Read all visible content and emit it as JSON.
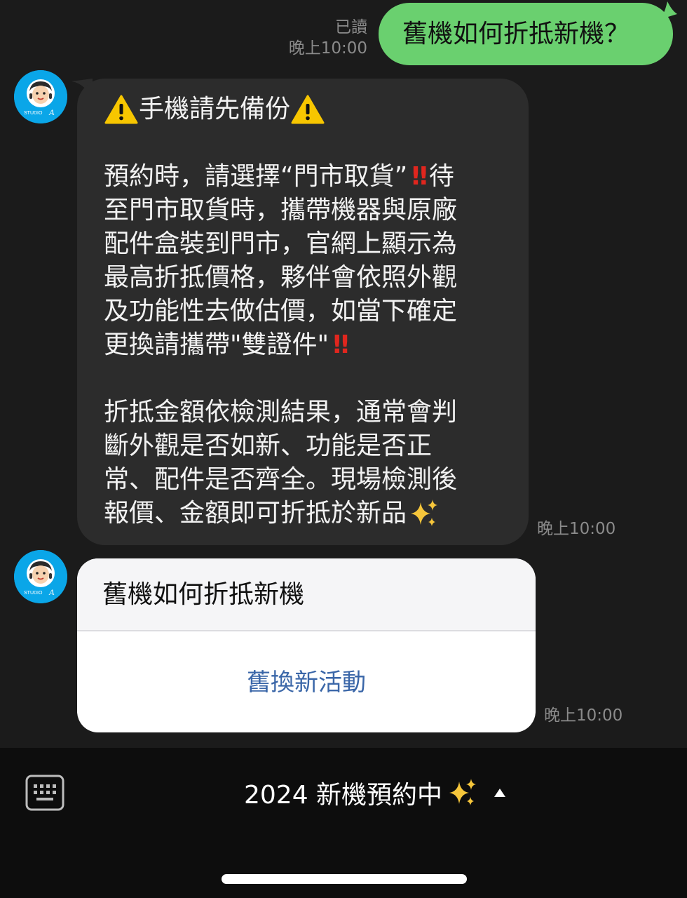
{
  "outgoing": {
    "read_status": "已讀",
    "time": "晚上10:00",
    "text": "舊機如何折抵新機？"
  },
  "incoming_message": {
    "title": "手機請先備份",
    "paragraph1": [
      "預約時，請選擇“門市取貨”",
      "待",
      "至門市取貨時，攜帶機器與原廠",
      "配件盒裝到門市，官網上顯示為",
      "最高折抵價格，夥伴會依照外觀",
      "及功能性去做估價，如當下確定",
      "更換請攜帶\"雙證件\""
    ],
    "paragraph2": [
      "折抵金額依檢測結果，通常會判",
      "斷外觀是否如新、功能是否正",
      "常、配件是否齊全。現場檢測後",
      "報價、金額即可折抵於新品"
    ],
    "bang_symbol": "‼",
    "time": "晚上10:00"
  },
  "card": {
    "title": "舊機如何折抵新機",
    "button_label": "舊換新活動",
    "time": "晚上10:00"
  },
  "bottom_bar": {
    "menu_label": "2024 新機預約中",
    "keyboard_icon": "keyboard-icon",
    "caret_icon": "caret-up-icon"
  },
  "colors": {
    "outgoing_bubble": "#6ad06f",
    "incoming_bubble": "#2c2c2c",
    "background": "#1b1b1b",
    "card_button_text": "#3a66a8"
  }
}
